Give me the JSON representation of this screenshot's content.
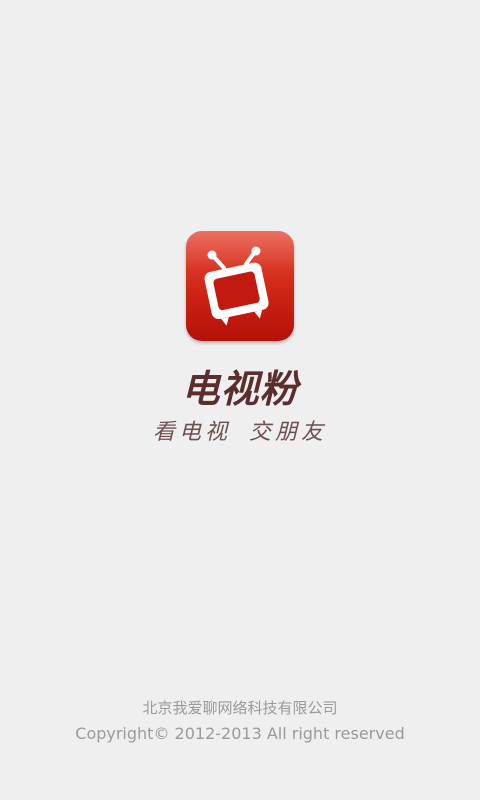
{
  "app": {
    "name": "电视粉",
    "slogan_part1": "看电视",
    "slogan_part2": "交朋友"
  },
  "footer": {
    "company": "北京我爱聊网络科技有限公司",
    "copyright": "Copyright© 2012-2013  All right reserved"
  },
  "colors": {
    "background": "#efefef",
    "icon_red": "#cf2414",
    "name_color": "#5b2d2d",
    "footer_text": "#9a9a9a"
  },
  "icons": {
    "logo": "tv-icon"
  }
}
